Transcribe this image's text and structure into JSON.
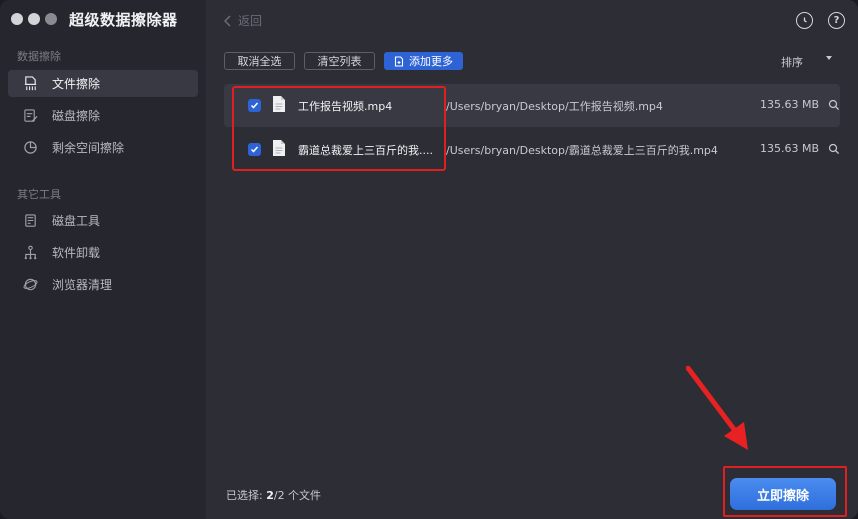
{
  "app": {
    "title": "超级数据擦除器"
  },
  "sidebar": {
    "section1_label": "数据擦除",
    "section2_label": "其它工具",
    "items": [
      {
        "label": "文件擦除",
        "icon": "file-shred-icon",
        "active": true
      },
      {
        "label": "磁盘擦除",
        "icon": "disk-erase-icon",
        "active": false
      },
      {
        "label": "剩余空间擦除",
        "icon": "pie-chart-icon",
        "active": false
      },
      {
        "label": "磁盘工具",
        "icon": "disk-tool-icon",
        "active": false
      },
      {
        "label": "软件卸载",
        "icon": "uninstall-icon",
        "active": false
      },
      {
        "label": "浏览器清理",
        "icon": "browser-clean-icon",
        "active": false
      }
    ]
  },
  "header": {
    "back_label": "返回"
  },
  "toolbar": {
    "deselect_all": "取消全选",
    "clear_list": "清空列表",
    "add_more": "添加更多",
    "sort": "排序"
  },
  "files": [
    {
      "name": "工作报告视频.mp4",
      "path": "/Users/bryan/Desktop/工作报告视频.mp4",
      "size": "135.63 MB",
      "checked": true
    },
    {
      "name": "霸道总裁爱上三百斤的我....",
      "path": "/Users/bryan/Desktop/霸道总裁爱上三百斤的我.mp4",
      "size": "135.63 MB",
      "checked": true
    }
  ],
  "status": {
    "prefix": "已选择: ",
    "count": "2",
    "suffix": "/2 个文件"
  },
  "actions": {
    "erase_now": "立即擦除"
  },
  "colors": {
    "accent": "#2e63d6",
    "annotation_red": "#e02020"
  }
}
